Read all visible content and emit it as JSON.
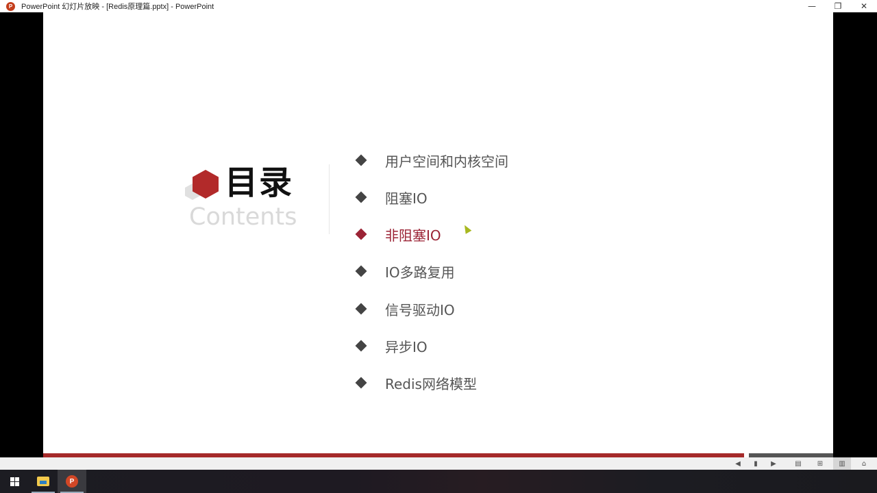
{
  "window": {
    "title": "PowerPoint 幻灯片放映 - [Redis原理篇.pptx] - PowerPoint",
    "app_icon_letter": "P",
    "controls": {
      "minimize": "—",
      "restore": "❐",
      "close": "✕"
    }
  },
  "slide": {
    "title_cn": "目录",
    "title_en": "Contents",
    "toc": [
      {
        "label": "用户空间和内核空间",
        "active": false
      },
      {
        "label": "阻塞IO",
        "active": false
      },
      {
        "label": "非阻塞IO",
        "active": true
      },
      {
        "label": "IO多路复用",
        "active": false
      },
      {
        "label": "信号驱动IO",
        "active": false
      },
      {
        "label": "异步IO",
        "active": false
      },
      {
        "label": "Redis网络模型",
        "active": false
      }
    ],
    "colors": {
      "accent": "#9b2335",
      "logo_red": "#b22a2a",
      "text": "#555555",
      "progress": "#a52a2a"
    }
  },
  "statusbar": {
    "icons": [
      "previous-icon",
      "slide-indicator-icon",
      "next-icon",
      "normal-view-icon",
      "slide-sorter-icon",
      "reading-view-icon",
      "slideshow-icon"
    ],
    "glyphs": [
      "◀",
      "▮",
      "▶",
      "▤",
      "⊞",
      "▥",
      "⌂"
    ]
  },
  "taskbar": {
    "items": [
      "start",
      "file-explorer",
      "powerpoint"
    ],
    "ppt_letter": "P"
  }
}
